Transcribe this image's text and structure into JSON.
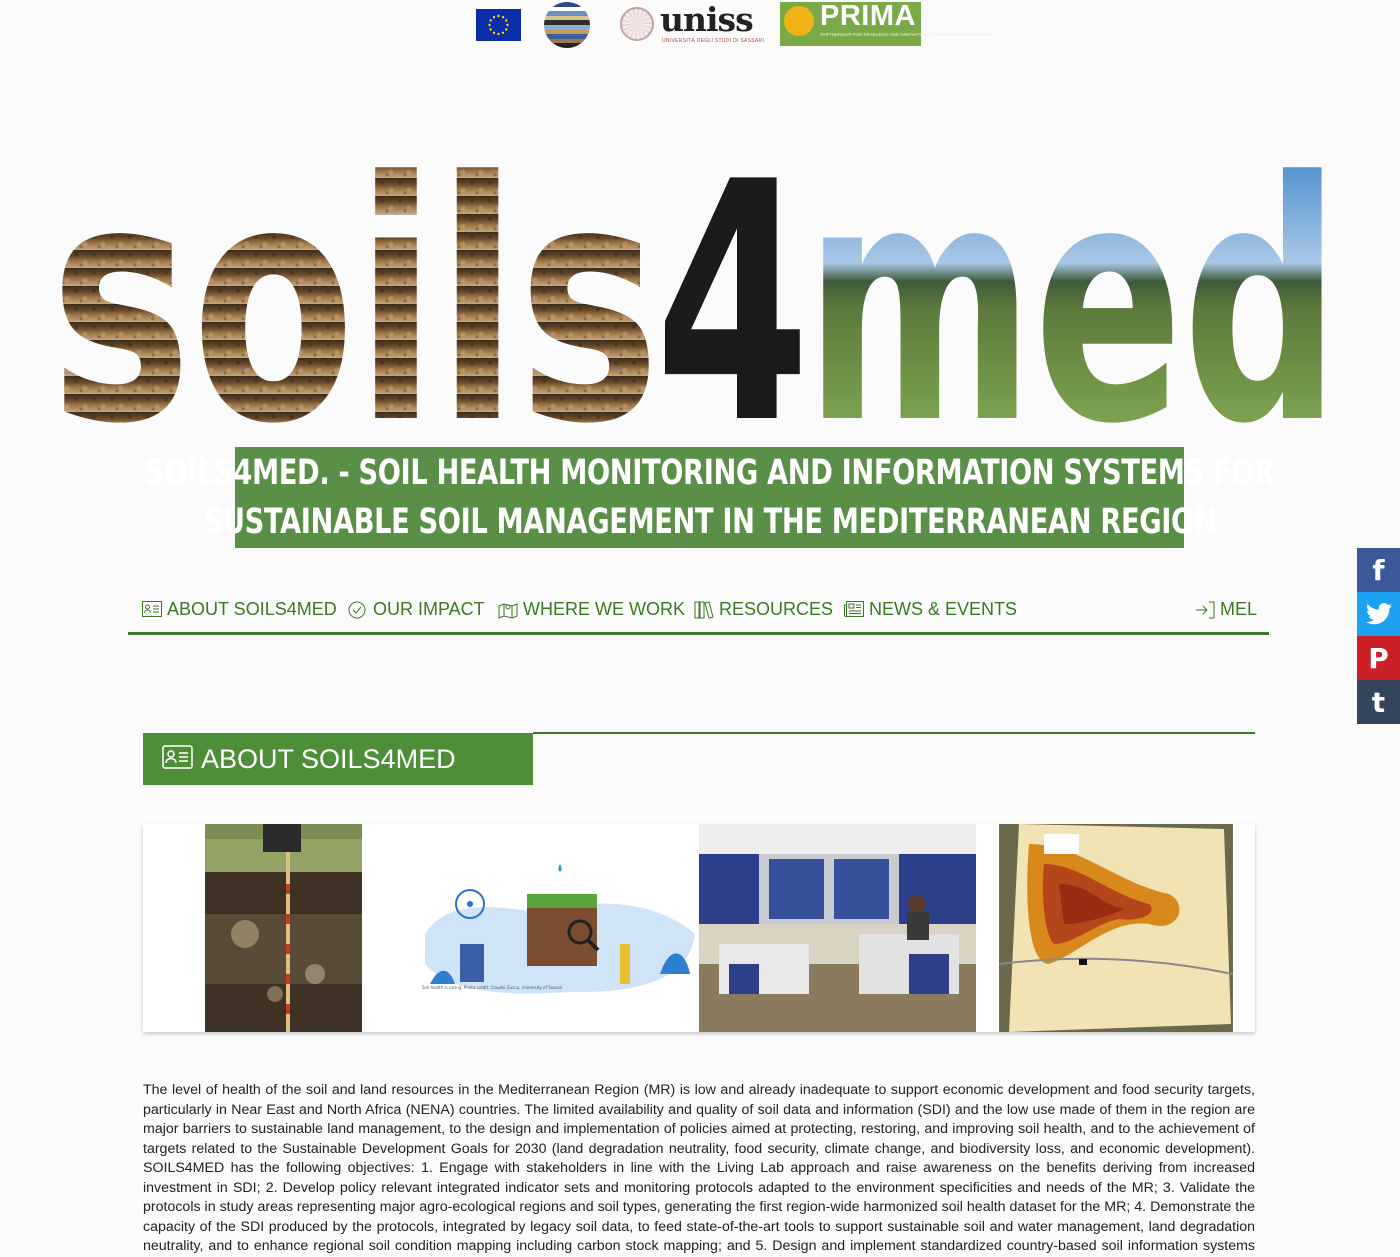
{
  "partners": {
    "uniss": {
      "name": "uniss",
      "subtitle": "UNIVERSITÀ DEGLI STUDI DI SASSARI"
    },
    "prima": {
      "name": "PRIMA",
      "subtitle": "PARTNERSHIP FOR RESEARCH AND INNOVATION IN THE MEDITERRANEAN AREA"
    }
  },
  "hero": {
    "soil_part": "soils",
    "digit": "4",
    "med_part": "med"
  },
  "title": {
    "line1": "SOILS4MED. - SOIL HEALTH MONITORING AND INFORMATION SYSTEMS FOR",
    "line2": "SUSTAINABLE SOIL MANAGEMENT IN THE MEDITERRANEAN REGION"
  },
  "nav": {
    "about": "ABOUT SOILS4MED",
    "impact": "OUR IMPACT",
    "where": "WHERE WE WORK",
    "resources": "RESOURCES",
    "news": "NEWS & EVENTS",
    "mel": "MEL"
  },
  "social": {
    "facebook": "f",
    "twitter": "twitter-icon",
    "pinterest": "P",
    "tumblr": "t",
    "colors": {
      "facebook": "#3b5998",
      "twitter": "#1da1f2",
      "pinterest": "#cb2027",
      "tumblr": "#35465c"
    }
  },
  "section": {
    "title": "ABOUT SOILS4MED"
  },
  "gallery": {
    "img2_caption": "Soil health is caring. Photo credit: Claudio Zucca, University of Sassari"
  },
  "body": {
    "paragraph": "The level of health of the soil and land resources in the Mediterranean Region (MR) is low and already inadequate to support economic development and food security targets, particularly in Near East and North Africa (NENA) countries. The limited availability and quality of soil data and information (SDI) and the low use made of them in the region are major barriers to sustainable land management, to the design and implementation of policies aimed at protecting, restoring, and improving soil health, and to the achievement of targets related to the Sustainable Development Goals for 2030 (land degradation neutrality, food security, climate change, and biodiversity loss, and economic development). SOILS4MED has the following objectives: 1. Engage with stakeholders in line with the Living Lab approach and raise awareness on the benefits deriving from increased investment in SDI;  2. Develop policy relevant integrated indicator sets and monitoring protocols adapted to the environment specificities and needs of the MR;  3. Validate the protocols in study areas representing major agro-ecological regions and soil types, generating the first region-wide harmonized soil health dataset for the MR;  4. Demonstrate the capacity of the SDI produced by the protocols, integrated by legacy soil data, to feed state-of-the-art tools to support sustainable soil and water management, land degradation neutrality, and to enhance regional soil condition mapping including carbon stock mapping; and  5. Design and implement standardized country-based soil information systems (SIS) for the effective"
  }
}
